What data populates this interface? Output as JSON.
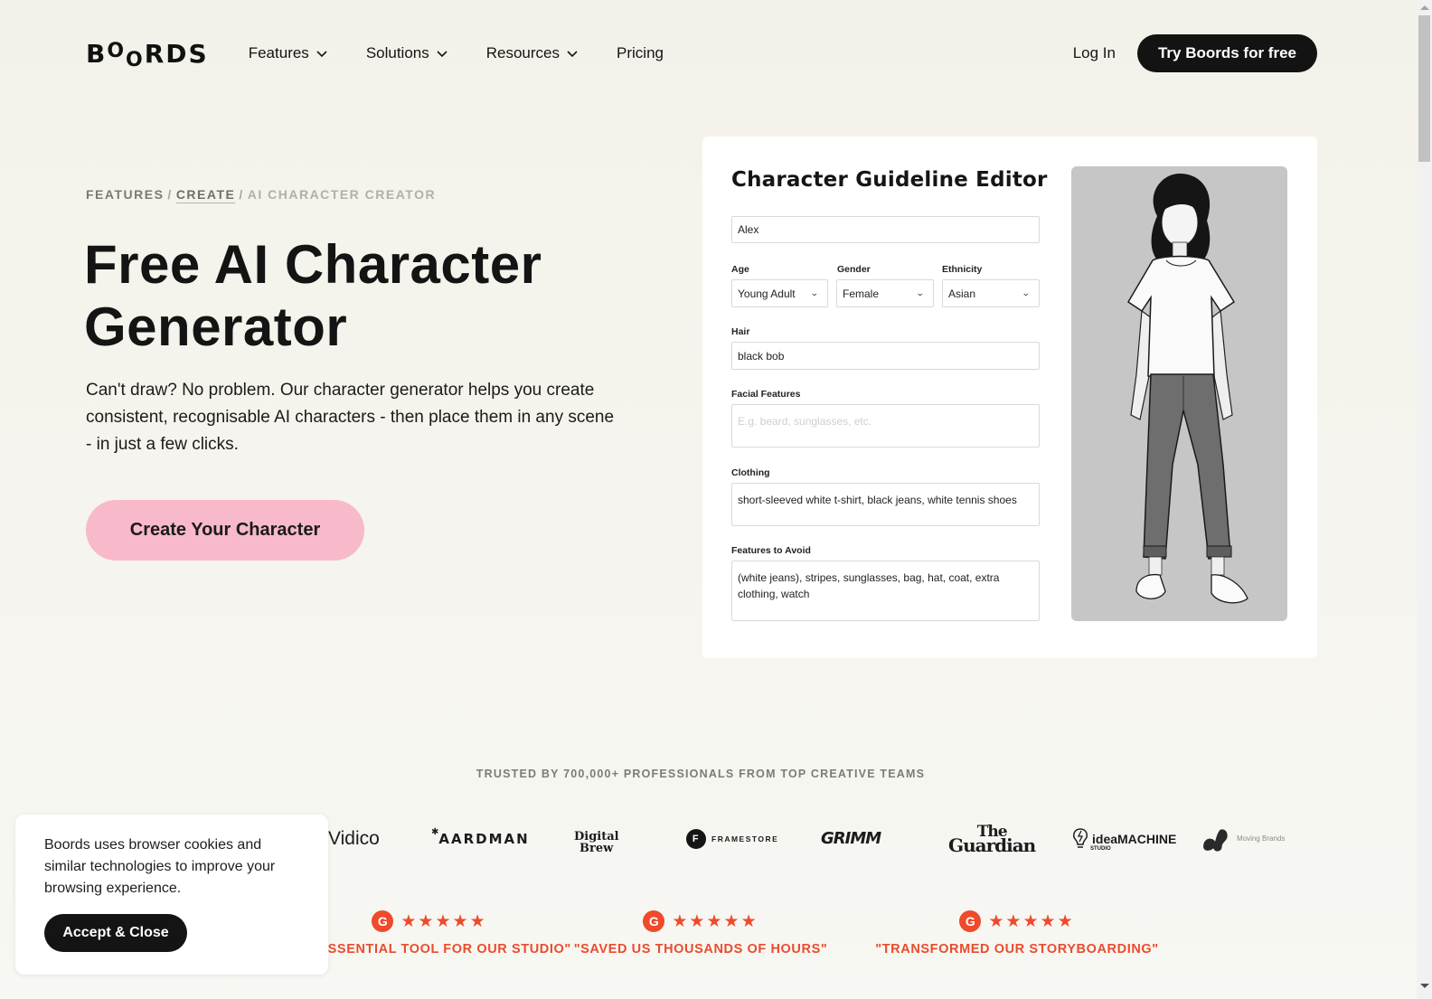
{
  "nav": {
    "logo": "BOORDS",
    "links": [
      {
        "label": "Features",
        "has_dropdown": true
      },
      {
        "label": "Solutions",
        "has_dropdown": true
      },
      {
        "label": "Resources",
        "has_dropdown": true
      },
      {
        "label": "Pricing",
        "has_dropdown": false
      }
    ],
    "login": "Log In",
    "cta": "Try Boords for free"
  },
  "breadcrumb": {
    "items": [
      "FEATURES",
      "CREATE",
      "AI CHARACTER CREATOR"
    ],
    "separator": "/"
  },
  "hero": {
    "title": "Free AI Character Generator",
    "description": "Can't draw? No problem. Our character generator helps you create consistent, recognisable AI characters - then place them in any scene - in just a few clicks.",
    "cta": "Create Your Character",
    "cta_color": "#f8b9cb"
  },
  "editor": {
    "title": "Character Guideline Editor",
    "name_value": "Alex",
    "age": {
      "label": "Age",
      "value": "Young Adult"
    },
    "gender": {
      "label": "Gender",
      "value": "Female"
    },
    "ethnicity": {
      "label": "Ethnicity",
      "value": "Asian"
    },
    "hair": {
      "label": "Hair",
      "value": "black bob"
    },
    "facial": {
      "label": "Facial Features",
      "value": "",
      "placeholder": "E.g. beard, sunglasses, etc."
    },
    "clothing": {
      "label": "Clothing",
      "value": "short-sleeved white t-shirt, black jeans, white tennis shoes"
    },
    "avoid": {
      "label": "Features to Avoid",
      "value": "(white jeans), stripes, sunglasses, bag, hat, coat, extra clothing, watch"
    },
    "image_alt": "Generated character illustration"
  },
  "trusted": {
    "heading": "TRUSTED BY 700,000+ PROFESSIONALS FROM TOP CREATIVE TEAMS",
    "logos": {
      "vidico": "Vidico",
      "aardman": "AARDMAN",
      "digital_line1": "Digital",
      "digital_line2": "Brew",
      "framestore_badge": "F",
      "framestore": "FRAMESTORE",
      "grim": "GRIMM",
      "guardian_line1": "The",
      "guardian_line2": "Guardian",
      "ideamachine": "ideaMACHINE",
      "ideamachine_sub": "STUDIO",
      "moving": "Moving Brands"
    }
  },
  "reviews": [
    {
      "badge": "G",
      "rating": 5,
      "quote": "\"AN ESSENTIAL TOOL FOR OUR STUDIO\""
    },
    {
      "badge": "G",
      "rating": 5,
      "quote": "\"SAVED US THOUSANDS OF HOURS\""
    },
    {
      "badge": "G",
      "rating": 5,
      "quote": "\"TRANSFORMED OUR STORYBOARDING\""
    }
  ],
  "review_color": "#ef4a2b",
  "cookie": {
    "text": "Boords uses browser cookies and similar technologies to improve your browsing experience.",
    "button": "Accept & Close"
  }
}
